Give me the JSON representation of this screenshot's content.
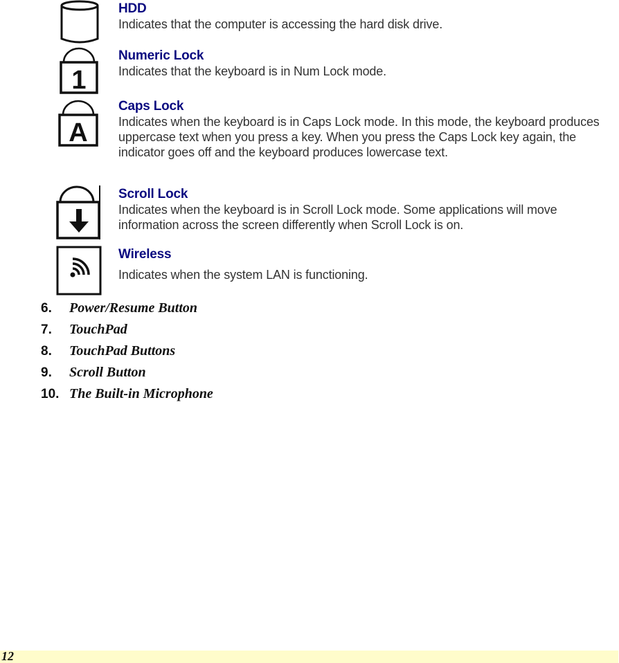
{
  "indicators": [
    {
      "icon": "hdd-cylinder-icon",
      "title": "HDD",
      "description": "Indicates that the computer is accessing the hard disk drive."
    },
    {
      "icon": "numeric-lock-icon",
      "title": "Numeric Lock",
      "description": "Indicates that the keyboard is in Num Lock mode."
    },
    {
      "icon": "caps-lock-icon",
      "title": "Caps Lock",
      "description": "Indicates when the keyboard is in Caps Lock mode.  In this mode, the keyboard produces uppercase text when you press a key.  When you press the Caps Lock key again, the indicator goes off and the keyboard produces lowercase text."
    },
    {
      "icon": "scroll-lock-icon",
      "title": "Scroll Lock",
      "description": "Indicates when the keyboard is in Scroll Lock mode.  Some applications will move information across the screen differently when Scroll Lock is on."
    },
    {
      "icon": "wireless-icon",
      "title": "Wireless",
      "description": "Indicates when the system LAN is functioning."
    }
  ],
  "icon_glyphs": {
    "numeric_lock": "1",
    "caps_lock": "A"
  },
  "list": [
    {
      "number": "6.",
      "label": "Power/Resume Button"
    },
    {
      "number": "7.",
      "label": "TouchPad"
    },
    {
      "number": "8.",
      "label": "TouchPad Buttons"
    },
    {
      "number": "9.",
      "label": "Scroll Button"
    },
    {
      "number": "10.",
      "label": "The Built-in Microphone"
    }
  ],
  "footer": {
    "page_number": "12"
  },
  "colors": {
    "heading": "#0a0a80",
    "body_text": "#333333",
    "footer_band": "#fffccb"
  }
}
